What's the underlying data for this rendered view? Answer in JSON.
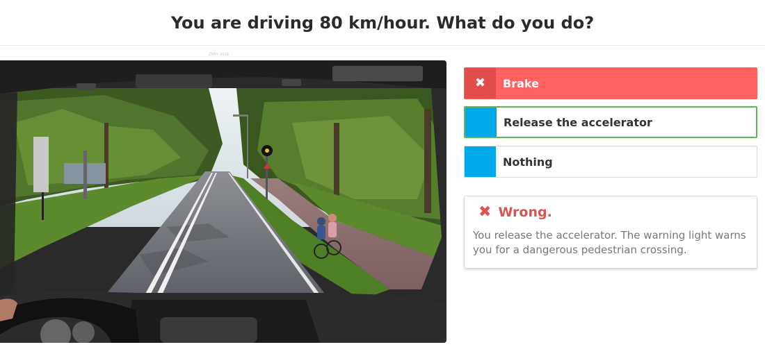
{
  "question": {
    "title": "You are driving 80 km/hour. What do you do?"
  },
  "image": {
    "caption": "ZWH-1018"
  },
  "answers": [
    {
      "label": "Brake",
      "state": "selected-wrong",
      "icon": "x-icon"
    },
    {
      "label": "Release the accelerator",
      "state": "correct"
    },
    {
      "label": "Nothing",
      "state": "neutral"
    }
  ],
  "feedback": {
    "heading": "Wrong.",
    "icon": "x-icon",
    "text": "You release the accelerator. The warning light warns you for a dangerous pedestrian crossing."
  },
  "colors": {
    "wrong": "#ff6261",
    "wrong_dark": "#e34d4c",
    "correct_border": "#5cb85c",
    "neutral_box": "#00a8e8",
    "feedback_heading": "#d9534f"
  }
}
